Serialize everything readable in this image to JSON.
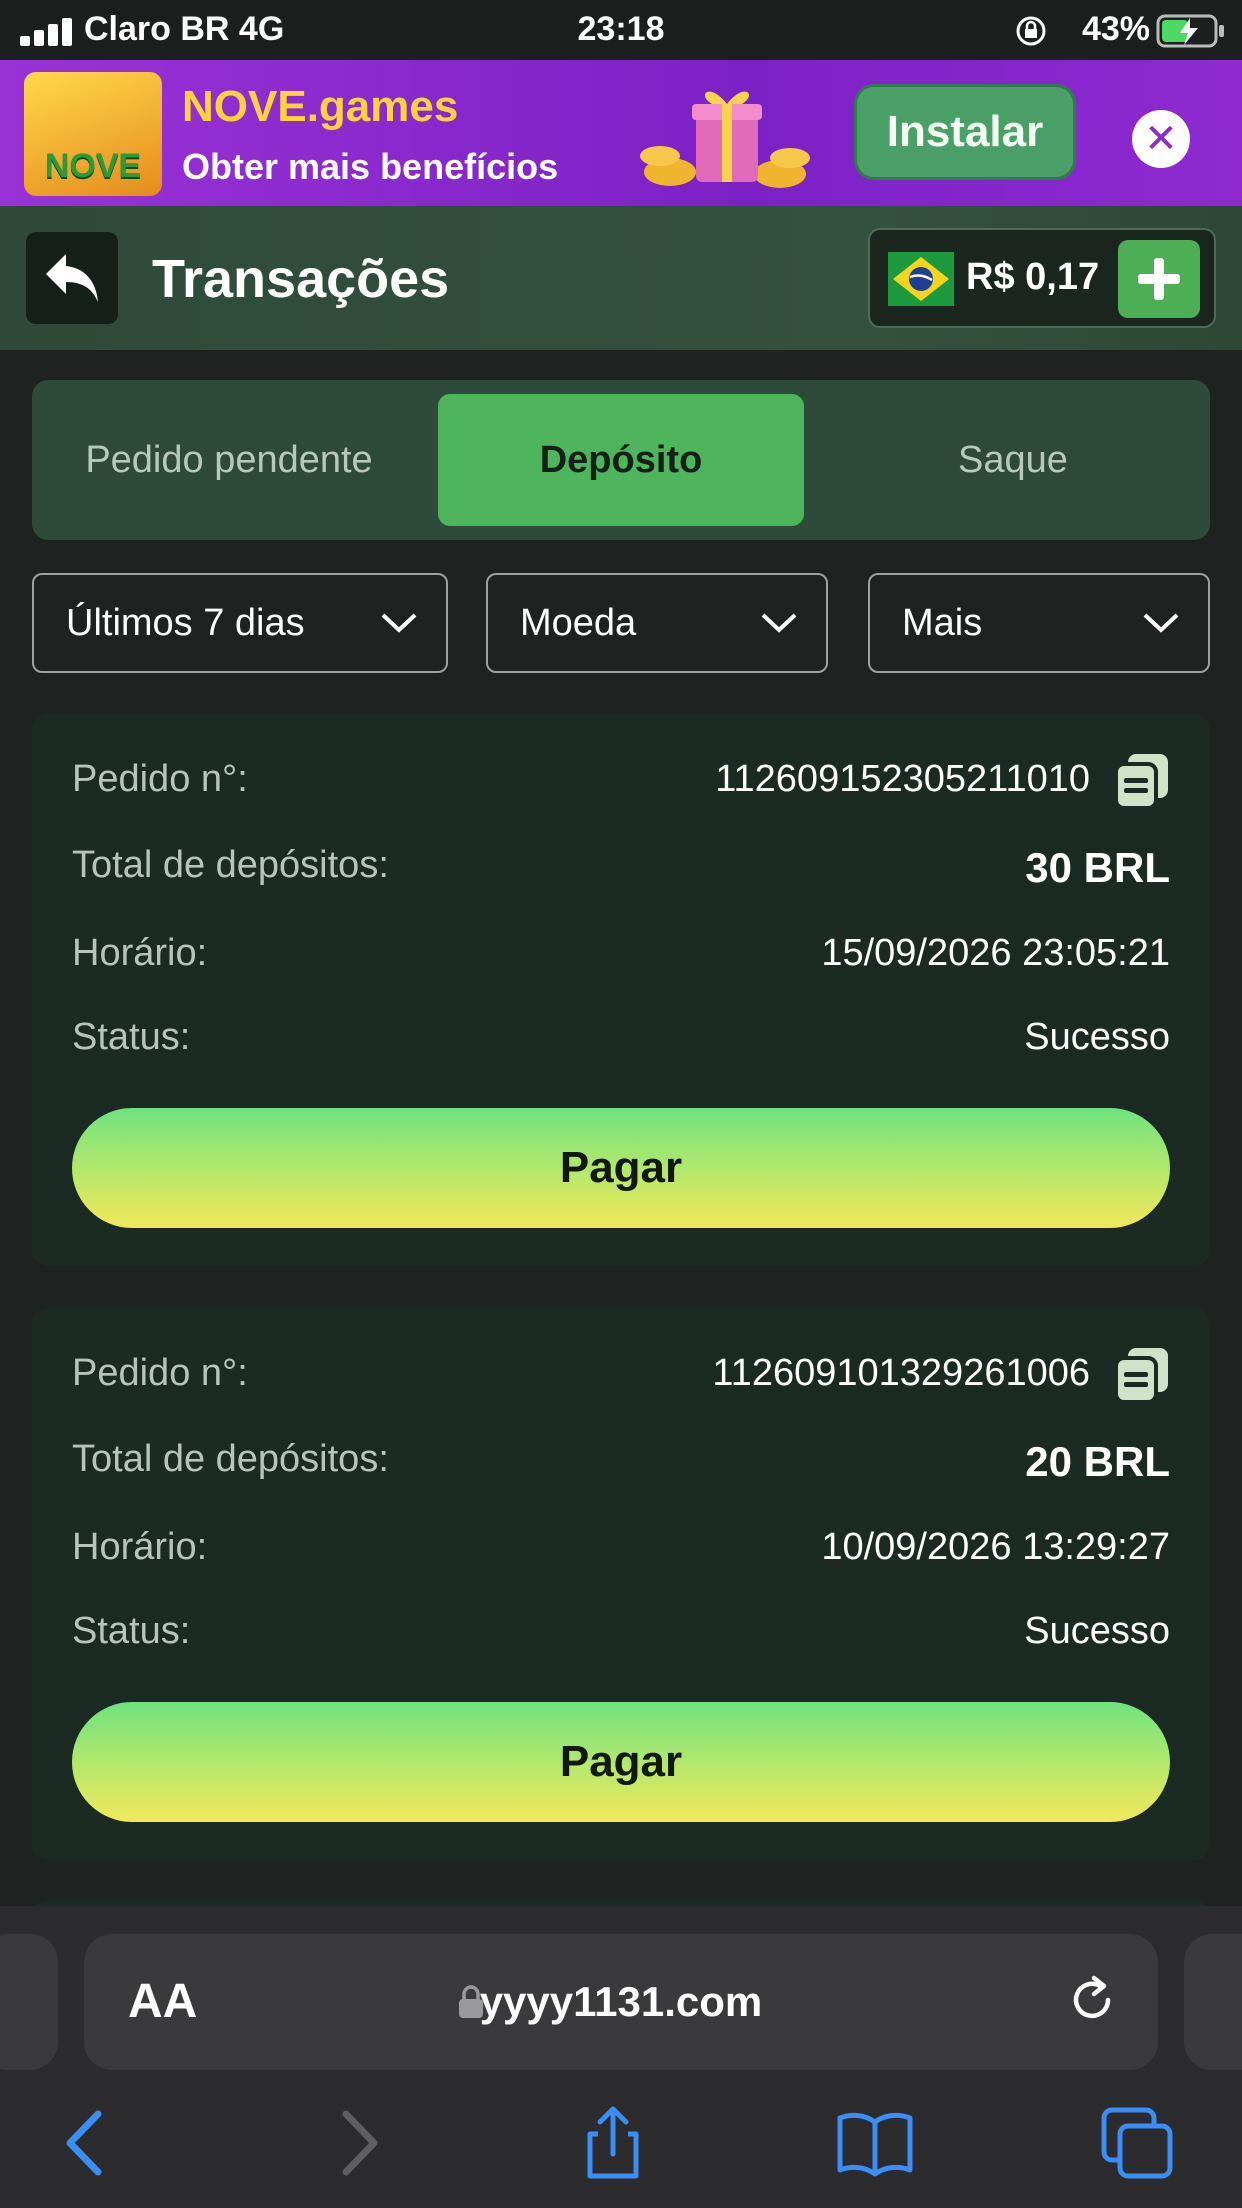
{
  "status_bar": {
    "carrier": "Claro BR  4G",
    "time": "23:18",
    "battery": "43%"
  },
  "banner": {
    "logo_text": "NOVE",
    "title": "NOVE.games",
    "subtitle": "Obter mais benefícios",
    "install_label": "Instalar",
    "close_icon": "close-icon"
  },
  "header": {
    "title": "Transações",
    "balance": "R$ 0,17"
  },
  "tabs": [
    {
      "label": "Pedido pendente",
      "active": false
    },
    {
      "label": "Depósito",
      "active": true
    },
    {
      "label": "Saque",
      "active": false
    }
  ],
  "filters": {
    "period": "Últimos 7 dias",
    "currency": "Moeda",
    "more": "Mais"
  },
  "labels": {
    "order": "Pedido n°:",
    "total": "Total de depósitos:",
    "time": "Horário:",
    "status": "Status:",
    "pay": "Pagar"
  },
  "transactions": [
    {
      "order": "112609152305211010",
      "total": "30 BRL",
      "time": "15/09/2026 23:05:21",
      "status": "Sucesso"
    },
    {
      "order": "112609101329261006",
      "total": "20 BRL",
      "time": "10/09/2026 13:29:27",
      "status": "Sucesso"
    }
  ],
  "browser": {
    "aa": "AA",
    "url": "yyyy1131.com"
  },
  "colors": {
    "accent": "#4eb55c",
    "banner": "#8e2ad0",
    "card": "#1b2b23",
    "ios_blue": "#3a8ef6"
  }
}
